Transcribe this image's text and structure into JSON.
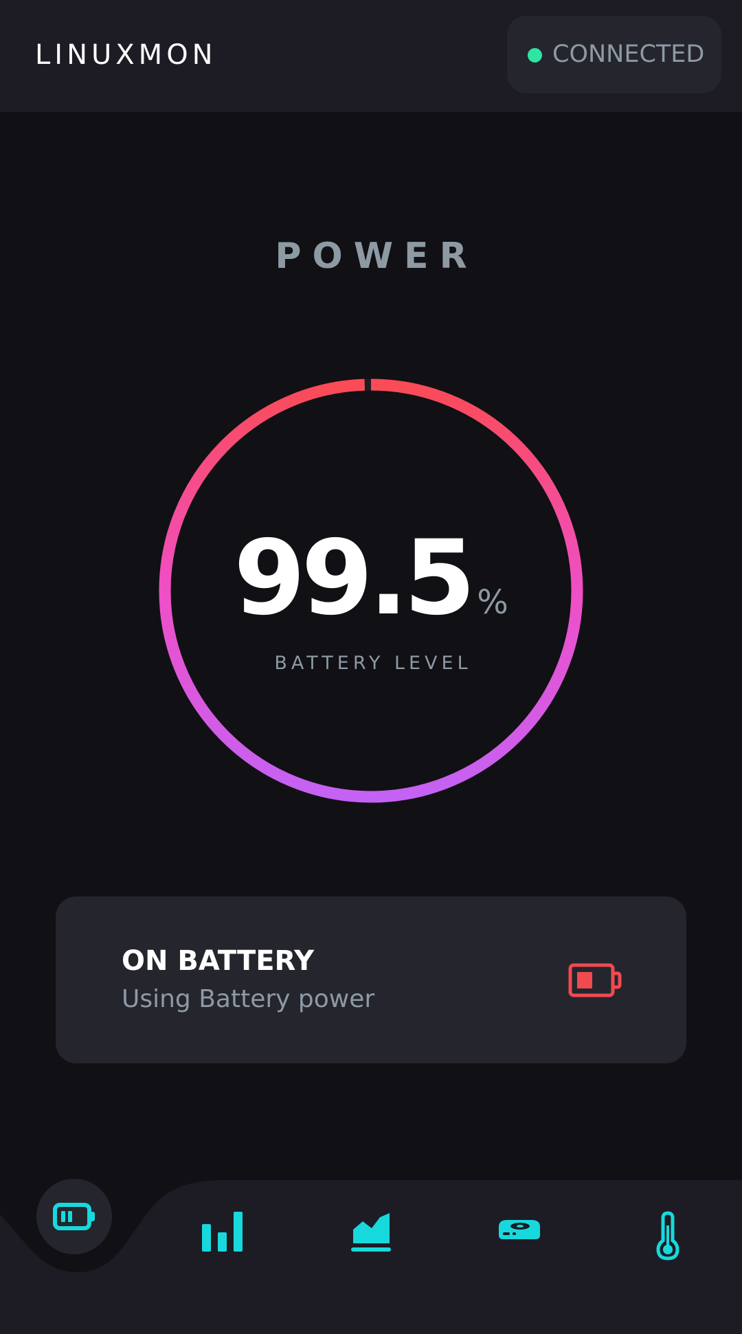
{
  "app": {
    "title": "LINUXMON"
  },
  "connection": {
    "label": "CONNECTED",
    "dot_color": "#2ee5a1"
  },
  "section": {
    "title": "POWER"
  },
  "gauge": {
    "value": "99.5",
    "unit": "%",
    "label": "BATTERY LEVEL",
    "fill_percent": 99.5,
    "gradient_colors": [
      "#c462f5",
      "#f04fc6",
      "#fa4b56"
    ]
  },
  "status": {
    "title": "ON BATTERY",
    "subtitle": "Using Battery power",
    "icon": "battery-low-icon",
    "icon_color": "#f04a4f"
  },
  "nav": {
    "accent_color": "#17d9dd",
    "items": [
      {
        "icon": "battery-icon",
        "active": true
      },
      {
        "icon": "bar-chart-icon",
        "active": false
      },
      {
        "icon": "area-chart-icon",
        "active": false
      },
      {
        "icon": "hard-drive-icon",
        "active": false
      },
      {
        "icon": "thermometer-icon",
        "active": false
      }
    ]
  },
  "colors": {
    "background": "#111014",
    "surface": "#1d1c24",
    "card": "#25252e",
    "muted_text": "#8d9aa4"
  }
}
